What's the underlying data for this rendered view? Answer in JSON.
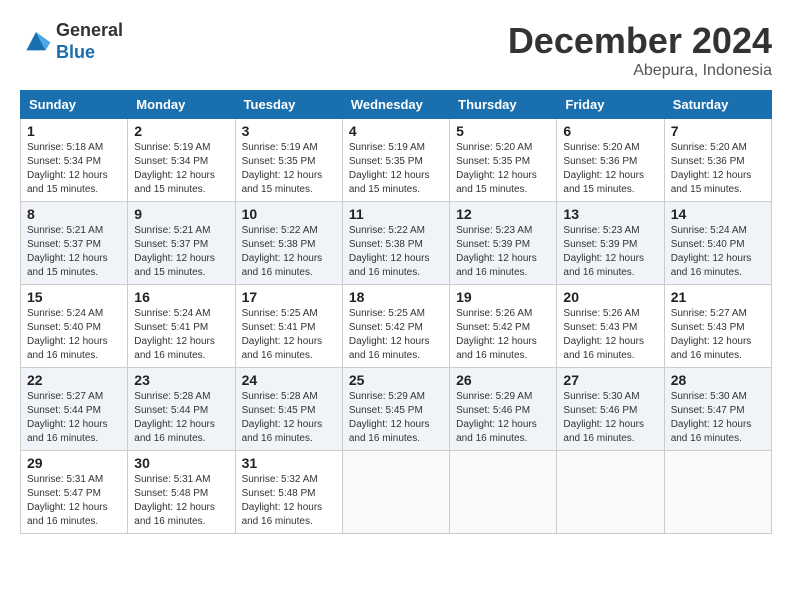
{
  "header": {
    "logo_general": "General",
    "logo_blue": "Blue",
    "month_title": "December 2024",
    "location": "Abepura, Indonesia"
  },
  "calendar": {
    "days_of_week": [
      "Sunday",
      "Monday",
      "Tuesday",
      "Wednesday",
      "Thursday",
      "Friday",
      "Saturday"
    ],
    "weeks": [
      [
        {
          "day": "1",
          "info": "Sunrise: 5:18 AM\nSunset: 5:34 PM\nDaylight: 12 hours and 15 minutes."
        },
        {
          "day": "2",
          "info": "Sunrise: 5:19 AM\nSunset: 5:34 PM\nDaylight: 12 hours and 15 minutes."
        },
        {
          "day": "3",
          "info": "Sunrise: 5:19 AM\nSunset: 5:35 PM\nDaylight: 12 hours and 15 minutes."
        },
        {
          "day": "4",
          "info": "Sunrise: 5:19 AM\nSunset: 5:35 PM\nDaylight: 12 hours and 15 minutes."
        },
        {
          "day": "5",
          "info": "Sunrise: 5:20 AM\nSunset: 5:35 PM\nDaylight: 12 hours and 15 minutes."
        },
        {
          "day": "6",
          "info": "Sunrise: 5:20 AM\nSunset: 5:36 PM\nDaylight: 12 hours and 15 minutes."
        },
        {
          "day": "7",
          "info": "Sunrise: 5:20 AM\nSunset: 5:36 PM\nDaylight: 12 hours and 15 minutes."
        }
      ],
      [
        {
          "day": "8",
          "info": "Sunrise: 5:21 AM\nSunset: 5:37 PM\nDaylight: 12 hours and 15 minutes."
        },
        {
          "day": "9",
          "info": "Sunrise: 5:21 AM\nSunset: 5:37 PM\nDaylight: 12 hours and 15 minutes."
        },
        {
          "day": "10",
          "info": "Sunrise: 5:22 AM\nSunset: 5:38 PM\nDaylight: 12 hours and 16 minutes."
        },
        {
          "day": "11",
          "info": "Sunrise: 5:22 AM\nSunset: 5:38 PM\nDaylight: 12 hours and 16 minutes."
        },
        {
          "day": "12",
          "info": "Sunrise: 5:23 AM\nSunset: 5:39 PM\nDaylight: 12 hours and 16 minutes."
        },
        {
          "day": "13",
          "info": "Sunrise: 5:23 AM\nSunset: 5:39 PM\nDaylight: 12 hours and 16 minutes."
        },
        {
          "day": "14",
          "info": "Sunrise: 5:24 AM\nSunset: 5:40 PM\nDaylight: 12 hours and 16 minutes."
        }
      ],
      [
        {
          "day": "15",
          "info": "Sunrise: 5:24 AM\nSunset: 5:40 PM\nDaylight: 12 hours and 16 minutes."
        },
        {
          "day": "16",
          "info": "Sunrise: 5:24 AM\nSunset: 5:41 PM\nDaylight: 12 hours and 16 minutes."
        },
        {
          "day": "17",
          "info": "Sunrise: 5:25 AM\nSunset: 5:41 PM\nDaylight: 12 hours and 16 minutes."
        },
        {
          "day": "18",
          "info": "Sunrise: 5:25 AM\nSunset: 5:42 PM\nDaylight: 12 hours and 16 minutes."
        },
        {
          "day": "19",
          "info": "Sunrise: 5:26 AM\nSunset: 5:42 PM\nDaylight: 12 hours and 16 minutes."
        },
        {
          "day": "20",
          "info": "Sunrise: 5:26 AM\nSunset: 5:43 PM\nDaylight: 12 hours and 16 minutes."
        },
        {
          "day": "21",
          "info": "Sunrise: 5:27 AM\nSunset: 5:43 PM\nDaylight: 12 hours and 16 minutes."
        }
      ],
      [
        {
          "day": "22",
          "info": "Sunrise: 5:27 AM\nSunset: 5:44 PM\nDaylight: 12 hours and 16 minutes."
        },
        {
          "day": "23",
          "info": "Sunrise: 5:28 AM\nSunset: 5:44 PM\nDaylight: 12 hours and 16 minutes."
        },
        {
          "day": "24",
          "info": "Sunrise: 5:28 AM\nSunset: 5:45 PM\nDaylight: 12 hours and 16 minutes."
        },
        {
          "day": "25",
          "info": "Sunrise: 5:29 AM\nSunset: 5:45 PM\nDaylight: 12 hours and 16 minutes."
        },
        {
          "day": "26",
          "info": "Sunrise: 5:29 AM\nSunset: 5:46 PM\nDaylight: 12 hours and 16 minutes."
        },
        {
          "day": "27",
          "info": "Sunrise: 5:30 AM\nSunset: 5:46 PM\nDaylight: 12 hours and 16 minutes."
        },
        {
          "day": "28",
          "info": "Sunrise: 5:30 AM\nSunset: 5:47 PM\nDaylight: 12 hours and 16 minutes."
        }
      ],
      [
        {
          "day": "29",
          "info": "Sunrise: 5:31 AM\nSunset: 5:47 PM\nDaylight: 12 hours and 16 minutes."
        },
        {
          "day": "30",
          "info": "Sunrise: 5:31 AM\nSunset: 5:48 PM\nDaylight: 12 hours and 16 minutes."
        },
        {
          "day": "31",
          "info": "Sunrise: 5:32 AM\nSunset: 5:48 PM\nDaylight: 12 hours and 16 minutes."
        },
        {
          "day": "",
          "info": ""
        },
        {
          "day": "",
          "info": ""
        },
        {
          "day": "",
          "info": ""
        },
        {
          "day": "",
          "info": ""
        }
      ]
    ]
  }
}
